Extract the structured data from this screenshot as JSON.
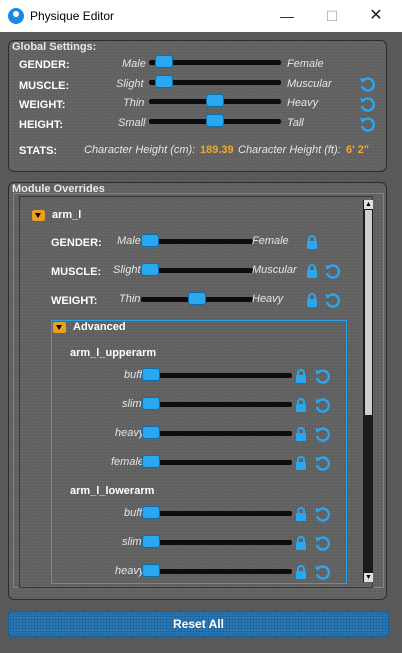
{
  "window": {
    "title": "Physique Editor",
    "minimize": "—",
    "maximize": "☐",
    "close": "✕"
  },
  "global": {
    "title": "Global Settings:",
    "rows": [
      {
        "label": "GENDER:",
        "low": "Male",
        "high": "Female",
        "value": 0.05
      },
      {
        "label": "MUSCLE:",
        "low": "Slight",
        "high": "Muscular",
        "value": 0.05
      },
      {
        "label": "WEIGHT:",
        "low": "Thin",
        "high": "Heavy",
        "value": 0.5
      },
      {
        "label": "HEIGHT:",
        "low": "Small",
        "high": "Tall",
        "value": 0.5
      }
    ],
    "stats": {
      "label": "STATS:",
      "height_cm_label": "Character Height (cm):",
      "height_cm": "189.39",
      "height_ft_label": "Character Height (ft):",
      "height_ft": "6' 2\""
    }
  },
  "modules": {
    "title": "Module Overrides",
    "arm": {
      "name": "arm_l",
      "rows": [
        {
          "label": "GENDER:",
          "low": "Male",
          "high": "Female",
          "value": 0.0
        },
        {
          "label": "MUSCLE:",
          "low": "Slight",
          "high": "Muscular",
          "value": 0.0
        },
        {
          "label": "WEIGHT:",
          "low": "Thin",
          "high": "Heavy",
          "value": 0.5
        }
      ],
      "advanced": {
        "title": "Advanced",
        "groups": [
          {
            "name": "arm_l_upperarm",
            "rows": [
              {
                "label": "buff",
                "value": 0.0
              },
              {
                "label": "slim",
                "value": 0.0
              },
              {
                "label": "heavy",
                "value": 0.0
              },
              {
                "label": "female",
                "value": 0.0
              }
            ]
          },
          {
            "name": "arm_l_lowerarm",
            "rows": [
              {
                "label": "buff",
                "value": 0.0
              },
              {
                "label": "slim",
                "value": 0.0
              },
              {
                "label": "heavy",
                "value": 0.0
              }
            ]
          }
        ]
      }
    }
  },
  "reset_all": "Reset All",
  "colors": {
    "accent": "#29a7f0",
    "stat": "#f0a830",
    "section_toggle": "#e8a020"
  },
  "icons": {
    "reset": "reset-icon",
    "lock": "lock-icon",
    "collapse": "caret-down-icon",
    "app": "person-icon"
  }
}
